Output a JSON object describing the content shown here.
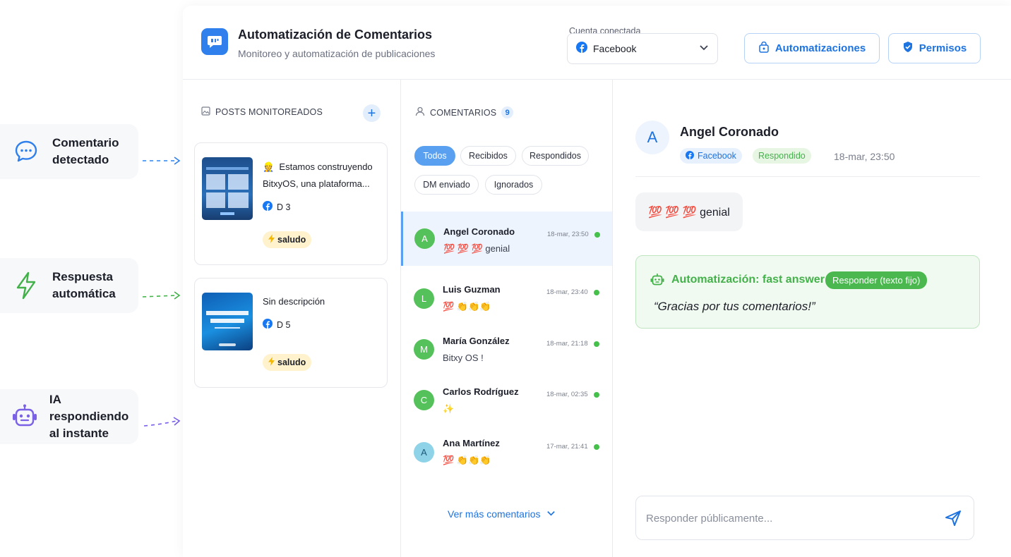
{
  "callouts": [
    {
      "label": "Comentario\ndetectado",
      "icon": "chat-bubble-icon",
      "color": "#2f80ed"
    },
    {
      "label": "Respuesta\nautomática",
      "icon": "lightning-icon",
      "color": "#43b14a"
    },
    {
      "label": "IA respondiendo\nal instante",
      "icon": "robot-icon",
      "color": "#7b61e6"
    }
  ],
  "header": {
    "title": "Automatización de Comentarios",
    "subtitle": "Monitoreo y automatización de publicaciones",
    "account_label": "Cuenta conectada",
    "account_value": "Facebook",
    "automations_button": "Automatizaciones",
    "permissions_button": "Permisos"
  },
  "posts": {
    "heading": "POSTS MONITOREADOS",
    "items": [
      {
        "emoji": "👷",
        "text": "Estamos construyendo BitxyOS, una plataforma...",
        "meta": "D 3",
        "tag": "saludo"
      },
      {
        "emoji": "",
        "text": "Sin descripción",
        "meta": "D 5",
        "tag": "saludo"
      }
    ]
  },
  "comments": {
    "heading": "COMENTARIOS",
    "count": "9",
    "filters": [
      "Todos",
      "Recibidos",
      "Respondidos",
      "DM enviado",
      "Ignorados"
    ],
    "active_filter": "Todos",
    "items": [
      {
        "initial": "A",
        "name": "Angel Coronado",
        "text": "💯 💯 💯  genial",
        "time": "18-mar, 23:50",
        "avatar_color": "#55c15a"
      },
      {
        "initial": "L",
        "name": "Luis Guzman",
        "text": "💯 👏👏👏",
        "time": "18-mar, 23:40",
        "avatar_color": "#55c15a"
      },
      {
        "initial": "M",
        "name": "María González",
        "text": "Bitxy OS !",
        "time": "18-mar, 21:18",
        "avatar_color": "#55c15a"
      },
      {
        "initial": "C",
        "name": "Carlos Rodríguez",
        "text": "✨",
        "time": "18-mar, 02:35",
        "avatar_color": "#55c15a"
      },
      {
        "initial": "A",
        "name": "Ana Martínez",
        "text": "💯 👏👏👏",
        "time": "17-mar, 21:41",
        "avatar_color": "#8fd3e8"
      }
    ],
    "more": "Ver más comentarios"
  },
  "detail": {
    "initial": "A",
    "name": "Angel Coronado",
    "platform": "Facebook",
    "status": "Respondido",
    "time": "18-mar, 23:50",
    "message": "💯 💯 💯  genial",
    "automation_title": "Automatización: fast answer",
    "automation_badge": "Responder (texto fijo)",
    "automation_message": "“Gracias por tus comentarios!”",
    "reply_placeholder": "Responder públicamente..."
  },
  "colors": {
    "accent": "#1d73e0",
    "success": "#43b14a",
    "facebook": "#1877f2"
  }
}
